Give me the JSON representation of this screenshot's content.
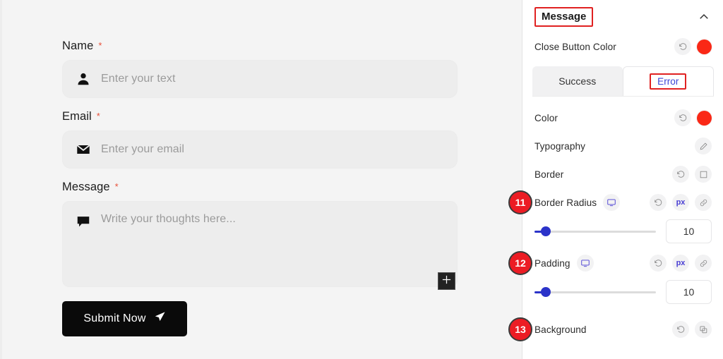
{
  "preview": {
    "fields": [
      {
        "label": "Name",
        "required": "*",
        "placeholder": "Enter your text",
        "icon": "user-icon"
      },
      {
        "label": "Email",
        "required": "*",
        "placeholder": "Enter your email",
        "icon": "envelope-icon"
      },
      {
        "label": "Message",
        "required": "*",
        "placeholder": "Write your thoughts here...",
        "icon": "chat-bubble-icon"
      }
    ],
    "submit_label": "Submit Now",
    "submit_icon": "send-icon",
    "add_widget_icon": "plus-icon",
    "submit_bg": "#0a0a0a",
    "input_bg": "#ededed",
    "background": "#f4f4f4"
  },
  "panel": {
    "title": "Message",
    "collapse_icon": "chevron-up-icon",
    "title_highlight_color": "#e02121",
    "close_button_color": {
      "label": "Close Button Color",
      "reset_icon": "reset-icon",
      "swatch": "#fa2816"
    },
    "tabs": [
      {
        "label": "Success",
        "active": false
      },
      {
        "label": "Error",
        "active": true
      }
    ],
    "rows": [
      {
        "label": "Color",
        "reset_icon": "reset-icon",
        "swatch": "#fa2816"
      },
      {
        "label": "Typography",
        "edit_icon": "pencil-icon"
      },
      {
        "label": "Border",
        "reset_icon": "reset-icon",
        "border_icon": "border-box-icon"
      }
    ],
    "border_radius": {
      "badge": "11",
      "label": "Border Radius",
      "device_icon": "monitor-icon",
      "reset_icon": "reset-icon",
      "unit": "px",
      "link_icon": "link-icon",
      "value": "10",
      "slider_percent": 8
    },
    "padding": {
      "badge": "12",
      "label": "Padding",
      "device_icon": "monitor-icon",
      "reset_icon": "reset-icon",
      "unit": "px",
      "link_icon": "link-icon",
      "value": "10",
      "slider_percent": 8
    },
    "background_row": {
      "badge": "13",
      "label": "Background",
      "reset_icon": "reset-icon",
      "layers_icon": "layers-icon"
    },
    "accent_color": "#4a3fd4",
    "slider_color": "#2b33c9",
    "badge_color": "#ec1c24"
  }
}
